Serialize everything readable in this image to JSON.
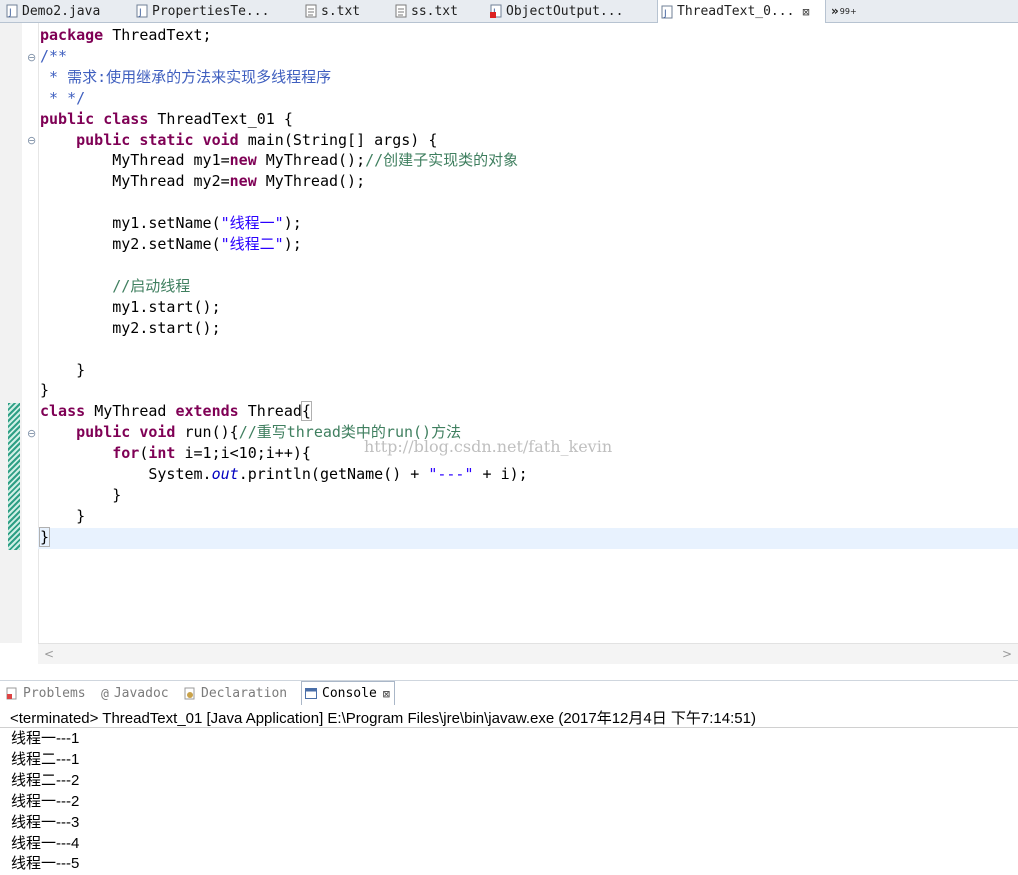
{
  "editor_tabs": [
    {
      "label": "Demo2.java",
      "icon": "java-file-icon",
      "active": false
    },
    {
      "label": "PropertiesTe...",
      "icon": "java-file-icon",
      "active": false
    },
    {
      "label": "s.txt",
      "icon": "text-file-icon",
      "active": false
    },
    {
      "label": "ss.txt",
      "icon": "text-file-icon",
      "active": false
    },
    {
      "label": "ObjectOutput...",
      "icon": "java-error-file-icon",
      "active": false
    },
    {
      "label": "ThreadText_0...",
      "icon": "java-file-icon",
      "active": true,
      "close": "⊠"
    }
  ],
  "tab_overflow": {
    "label": "»",
    "count": "99+"
  },
  "code": {
    "package_kw": "package",
    "package_name": "ThreadText;",
    "doc_open": "/**",
    "doc_line1": " * 需求:使用继承的方法来实现多线程程序",
    "doc_close": " * */",
    "public_kw": "public",
    "class_kw": "class",
    "class1_name": "ThreadText_01 {",
    "static_kw": "static",
    "void_kw": "void",
    "main_sig": "main(String[] args) {",
    "new_kw": "new",
    "decl1_a": "MyThread my1=",
    "decl1_b": "MyThread();",
    "decl1_comment": "//创建子实现类的对象",
    "decl2_a": "MyThread my2=",
    "decl2_b": "MyThread();",
    "setname1_a": "my1.setName(",
    "setname1_str": "\"线程一\"",
    "setname2_a": "my2.setName(",
    "setname2_str": "\"线程二\"",
    "paren_semi": ");",
    "start_comment": "//启动线程",
    "start1": "my1.start();",
    "start2": "my2.start();",
    "close_brace": "}",
    "class2_name": "MyThread",
    "extends_kw": "extends",
    "thread_name": "Thread",
    "run_sig": "run(){",
    "run_comment": "//重写thread类中的run()方法",
    "for_kw": "for",
    "int_kw": "int",
    "for_rest": " i=1;i<10;i++){",
    "println_a": "System.",
    "println_field": "out",
    "println_b": ".println(getName() + ",
    "println_str": "\"---\"",
    "println_c": " + i);"
  },
  "watermark": "http://blog.csdn.net/fath_kevin",
  "view_tabs": [
    {
      "label": "Problems",
      "icon": "problems-icon",
      "active": false
    },
    {
      "label": "Javadoc",
      "icon": "at-sign-icon",
      "active": false
    },
    {
      "label": "Declaration",
      "icon": "declaration-icon",
      "active": false
    },
    {
      "label": "Console",
      "icon": "console-icon",
      "active": true,
      "close": "⊠"
    }
  ],
  "console": {
    "status": "<terminated> ThreadText_01 [Java Application] E:\\Program Files\\jre\\bin\\javaw.exe (2017年12月4日 下午7:14:51)",
    "lines": [
      "线程一---1",
      "线程二---1",
      "线程二---2",
      "线程一---2",
      "线程一---3",
      "线程一---4",
      "线程一---5"
    ]
  },
  "colors": {
    "keyword": "#7f0055",
    "comment": "#3f7f5f",
    "javadoc": "#3f5fbf",
    "string": "#2a00ff",
    "current_line": "#e8f2fe",
    "change_bar": "#2e9f85"
  }
}
